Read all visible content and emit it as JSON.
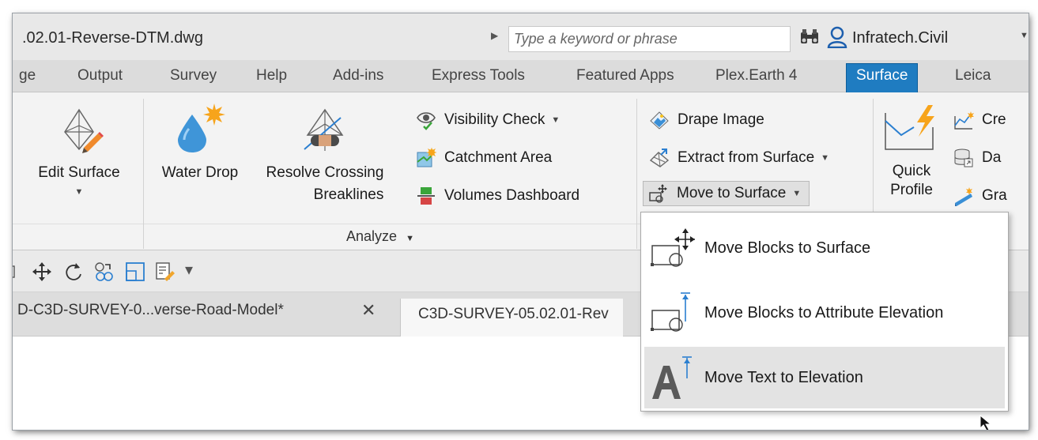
{
  "titlebar": {
    "document_title": ".02.01-Reverse-DTM.dwg",
    "search_placeholder": "Type a keyword or phrase",
    "user_name": "Infratech.Civil"
  },
  "tabs": [
    {
      "label": "ge"
    },
    {
      "label": "Output"
    },
    {
      "label": "Survey"
    },
    {
      "label": "Help"
    },
    {
      "label": "Add-ins"
    },
    {
      "label": "Express Tools"
    },
    {
      "label": "Featured Apps"
    },
    {
      "label": "Plex.Earth 4"
    },
    {
      "label": "Surface",
      "active": true
    },
    {
      "label": "Leica"
    }
  ],
  "ribbon": {
    "edit_surface": "Edit Surface",
    "water_drop": "Water Drop",
    "resolve_crossing_line1": "Resolve Crossing",
    "resolve_crossing_line2": "Breaklines",
    "visibility_check": "Visibility Check",
    "catchment_area": "Catchment Area",
    "volumes_dashboard": "Volumes Dashboard",
    "analyze_group": "Analyze",
    "drape_image": "Drape Image",
    "extract_from_surface": "Extract from Surface",
    "move_to_surface": "Move to Surface",
    "quick_profile_line1": "Quick",
    "quick_profile_line2": "Profile",
    "create_partial": "Cre",
    "data_partial": "Da",
    "grade_partial": "Gra"
  },
  "doc_tabs": {
    "tab1": "D-C3D-SURVEY-0...verse-Road-Model*",
    "tab2": "C3D-SURVEY-05.02.01-Rev"
  },
  "dropdown_menu": {
    "items": [
      {
        "label": "Move Blocks to Surface"
      },
      {
        "label": "Move Blocks to Attribute Elevation"
      },
      {
        "label": "Move Text to Elevation"
      }
    ]
  },
  "colors": {
    "active_tab": "#1f7cc1",
    "accent_blue": "#2b7fd0",
    "hover_bg": "#e3e3e3"
  }
}
